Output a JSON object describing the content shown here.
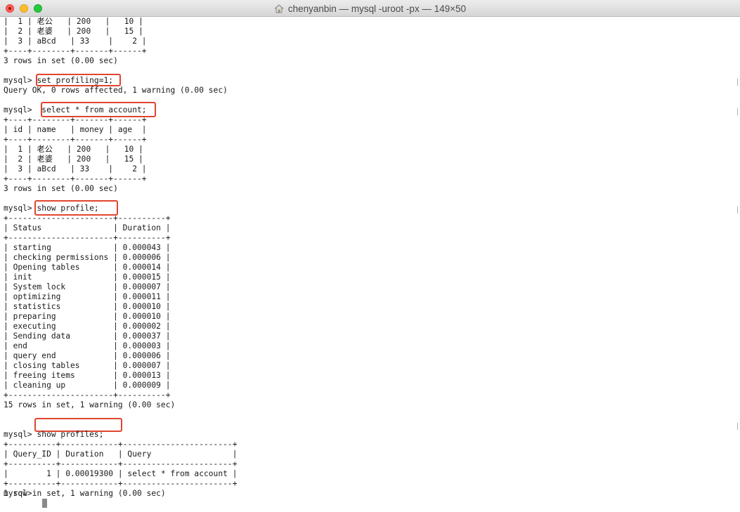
{
  "window": {
    "title": "chenyanbin — mysql -uroot -px — 149×50",
    "home_icon": "house-icon"
  },
  "terminal": {
    "lines": [
      "|  1 | 老公   | 200   |   10 |",
      "|  2 | 老婆   | 200   |   15 |",
      "|  3 | aBcd   | 33    |    2 |",
      "+----+--------+-------+------+",
      "3 rows in set (0.00 sec)",
      "",
      "mysql> set profiling=1;",
      "Query OK, 0 rows affected, 1 warning (0.00 sec)",
      "mysql>  select * from account;",
      "+----+--------+-------+------+",
      "| id | name   | money | age  |",
      "+----+--------+-------+------+",
      "|  1 | 老公   | 200   |   10 |",
      "|  2 | 老婆   | 200   |   15 |",
      "|  3 | aBcd   | 33    |    2 |",
      "+----+--------+-------+------+",
      "3 rows in set (0.00 sec)",
      "",
      "mysql> show profile;",
      "+----------------------+----------+",
      "| Status               | Duration |",
      "+----------------------+----------+",
      "| starting             | 0.000043 |",
      "| checking permissions | 0.000006 |",
      "| Opening tables       | 0.000014 |",
      "| init                 | 0.000015 |",
      "| System lock          | 0.000007 |",
      "| optimizing           | 0.000011 |",
      "| statistics           | 0.000010 |",
      "| preparing            | 0.000010 |",
      "| executing            | 0.000002 |",
      "| Sending data         | 0.000037 |",
      "| end                  | 0.000003 |",
      "| query end            | 0.000006 |",
      "| closing tables       | 0.000007 |",
      "| freeing items        | 0.000013 |",
      "| cleaning up          | 0.000009 |",
      "+----------------------+----------+",
      "15 rows in set, 1 warning (0.00 sec)",
      "",
      "mysql> show profiles;",
      "+----------+------------+-----------------------+",
      "| Query_ID | Duration   | Query                 |",
      "+----------+------------+-----------------------+",
      "|        1 | 0.00019300 | select * from account |",
      "+----------+------------+-----------------------+",
      "1 row in set, 1 warning (0.00 sec)",
      "",
      "mysql> "
    ]
  },
  "colors": {
    "highlight": "#e0452f",
    "text": "#1a1a1a",
    "cursor": "#8a8a8a"
  }
}
